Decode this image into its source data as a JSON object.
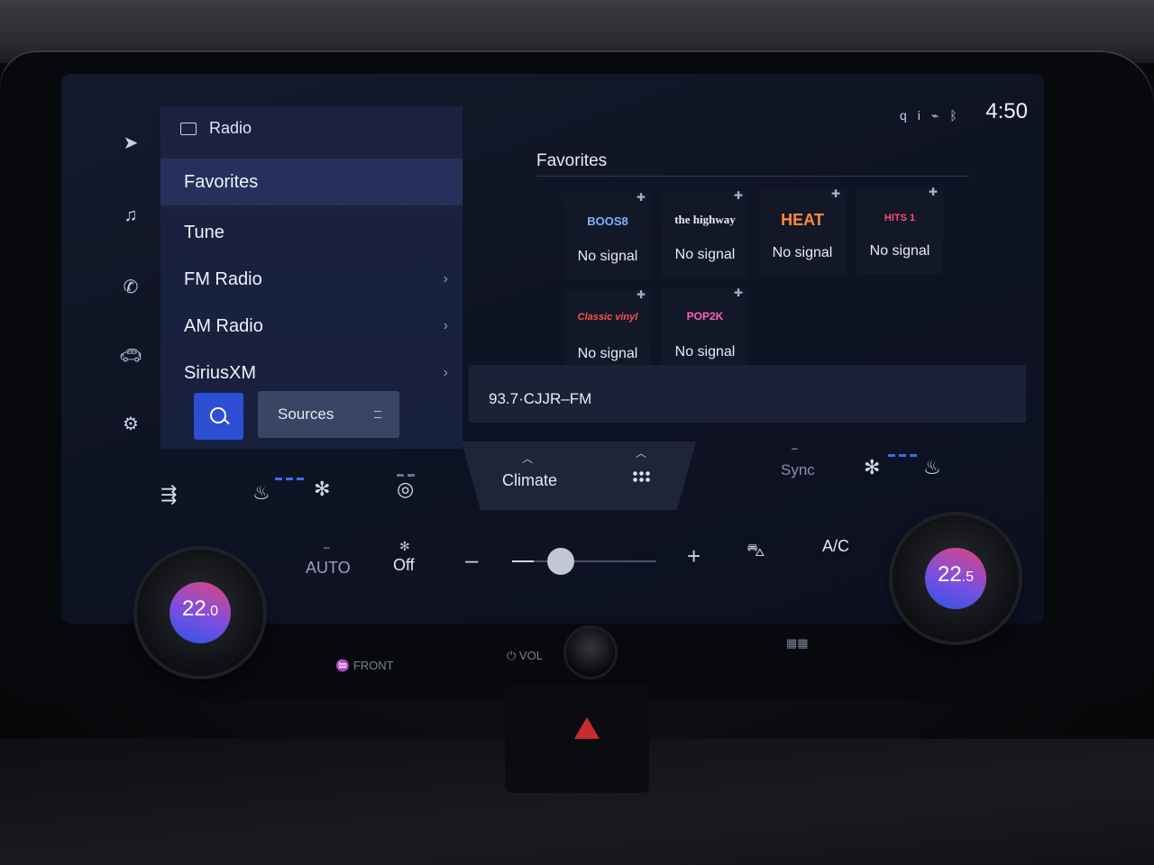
{
  "status": {
    "time": "4:50",
    "icons": [
      "qi-charging-icon",
      "signal-icon",
      "bluetooth-icon"
    ]
  },
  "rail": {
    "icons": [
      "navigation-icon",
      "music-icon",
      "phone-icon",
      "car-icon",
      "settings-icon"
    ]
  },
  "menu": {
    "header": "Radio",
    "items": [
      {
        "label": "Favorites",
        "active": true,
        "chevron": false
      },
      {
        "label": "Tune",
        "active": false,
        "chevron": false
      },
      {
        "label": "FM Radio",
        "active": false,
        "chevron": true
      },
      {
        "label": "AM Radio",
        "active": false,
        "chevron": true
      },
      {
        "label": "SiriusXM",
        "active": false,
        "chevron": true
      }
    ],
    "chevron_glyph": "›",
    "sources_label": "Sources"
  },
  "favorites": {
    "title": "Favorites",
    "tiles": [
      {
        "logo": "BOOS8",
        "status": "No signal",
        "color": "#7fb2ff"
      },
      {
        "logo": "the highway",
        "status": "No signal",
        "color": "#e8ecf4"
      },
      {
        "logo": "HEAT",
        "status": "No signal",
        "color": "#ff8a3a"
      },
      {
        "logo": "HITS 1",
        "status": "No signal",
        "color": "#ff4d6d"
      },
      {
        "logo": "Classic vinyl",
        "status": "No signal",
        "color": "#ff5050"
      },
      {
        "logo": "POP2K",
        "status": "No signal",
        "color": "#ff5fb8"
      }
    ]
  },
  "now_playing": {
    "station": "93.7·CJJR–FM"
  },
  "climate": {
    "tab_label": "Climate",
    "sync_label": "Sync",
    "auto_label": "AUTO",
    "fan_label": "Off",
    "ac_label": "A/C",
    "minus": "–",
    "plus": "+",
    "fan_level": 0.15,
    "left_temp": {
      "whole": "22",
      "decimal": ".0"
    },
    "right_temp": {
      "whole": "22",
      "decimal": ".5"
    }
  },
  "hardware": {
    "front_label": "FRONT",
    "vol_label": "VOL"
  },
  "colors": {
    "accent": "#2c4fd6",
    "active_row": "#26305a",
    "seat_dots": "#3c6cf0"
  }
}
